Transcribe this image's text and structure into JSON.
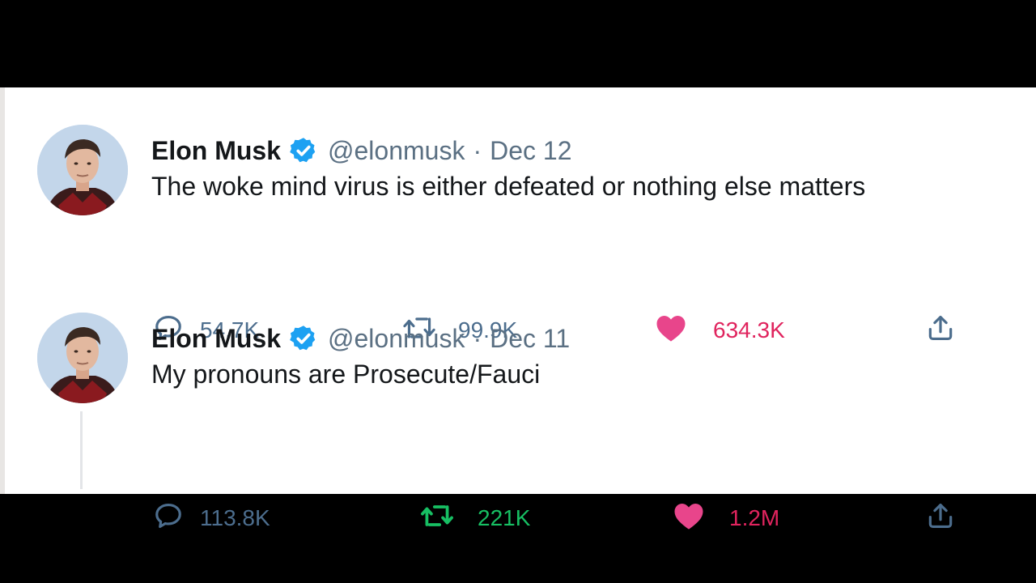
{
  "tweets": [
    {
      "name": "Elon Musk",
      "handle": "@elonmusk",
      "separator": "·",
      "date": "Dec 12",
      "text": "The woke mind virus is either defeated or nothing else matters",
      "replies": "54.7K",
      "retweets": "99.9K",
      "likes": "634.3K",
      "retweeted": false,
      "liked": true
    },
    {
      "name": "Elon Musk",
      "handle": "@elonmusk",
      "separator": "·",
      "date": "Dec 11",
      "text": "My pronouns are Prosecute/Fauci",
      "replies": "113.8K",
      "retweets": "221K",
      "likes": "1.2M",
      "retweeted": true,
      "liked": true
    }
  ],
  "colors": {
    "muted": "#5b7083",
    "counter": "#4c6d8d",
    "verified": "#1da1f2",
    "like": "#e0245e",
    "retweet": "#17bf63"
  },
  "icons": {
    "reply": "reply-icon",
    "retweet": "retweet-icon",
    "like": "heart-icon",
    "share": "share-icon",
    "verified": "verified-badge-icon"
  }
}
